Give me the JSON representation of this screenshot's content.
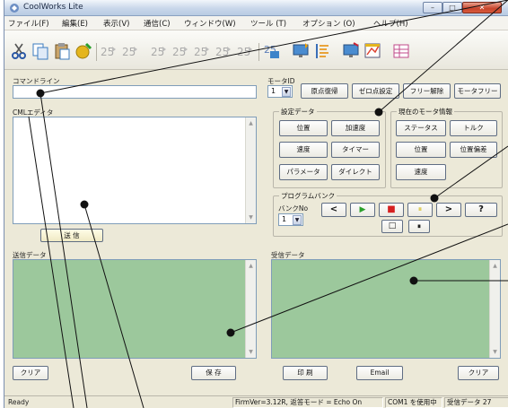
{
  "window": {
    "title": "CoolWorks Lite",
    "min": "–",
    "max": "□",
    "close": "✕"
  },
  "menu": [
    "ファイル(F)",
    "編集(E)",
    "表示(V)",
    "通信(C)",
    "ウィンドウ(W)",
    "ツール (T)",
    "オプション (O)",
    "ヘルプ(H)"
  ],
  "toolbar_icons": [
    "scissors-icon",
    "copy-icon",
    "paste-icon",
    "connect-icon",
    "send-program-icon",
    "receive-program-icon",
    "program-icon",
    "program-2-icon",
    "program-3-icon",
    "program-4-icon",
    "program-5-icon",
    "motor-settings-icon",
    "list-icon",
    "monitor-icon",
    "graph-icon",
    "table-icon"
  ],
  "command_line": {
    "label": "コマンドライン",
    "value": ""
  },
  "cml_editor": {
    "label": "CMLエディタ",
    "send_label": "送 信"
  },
  "motor_id": {
    "label": "モータID",
    "value": "1"
  },
  "top_buttons": {
    "origin_return": "原点復帰",
    "zero_set": "ゼロ点設定",
    "free_release": "フリー解除",
    "motor_free": "モータフリー"
  },
  "settings_data": {
    "title": "設定データ",
    "buttons": [
      "位置",
      "加速度",
      "速度",
      "タイマー",
      "パラメータ",
      "ダイレクト"
    ]
  },
  "motor_info": {
    "title": "現在のモータ情報",
    "buttons": [
      "ステータス",
      "トルク",
      "位置",
      "位置偏差",
      "速度"
    ]
  },
  "program_bank": {
    "title": "プログラムバンク",
    "bank_label": "バンクNo",
    "bank_value": "1",
    "controls": [
      "<",
      "▶",
      "■",
      "⏸",
      ">",
      "?",
      "□",
      "⏸"
    ]
  },
  "send_data": {
    "label": "送信データ",
    "clear": "クリア",
    "save": "保 存"
  },
  "receive_data": {
    "label": "受信データ",
    "print": "印 刷",
    "email": "Email",
    "clear": "クリア"
  },
  "status": {
    "ready": "Ready",
    "firmware": "FirmVer=3.12R, 返答モード = Echo On",
    "port": "COM1 を使用中",
    "receive": "受信データ 27"
  },
  "colors": {
    "data_panel": "#9cc89c",
    "play": "#2aa02a",
    "stop": "#d62020",
    "pause": "#e8d64a"
  }
}
